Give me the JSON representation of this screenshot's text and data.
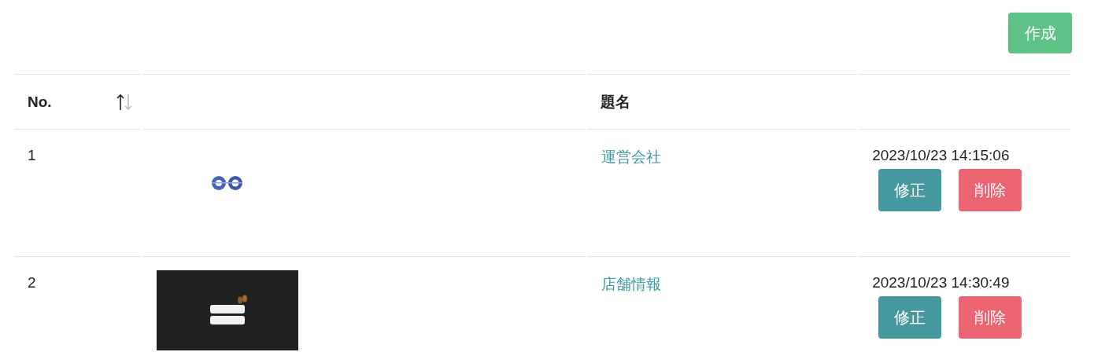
{
  "create_button": "作成",
  "table": {
    "columns": [
      {
        "label": "No.",
        "sortable": true
      },
      {
        "sortable": false
      },
      {
        "label": "題名",
        "sortable": false
      },
      {
        "sortable": false
      }
    ],
    "rows": [
      {
        "no": "1",
        "title": "運営会社",
        "date": "2023/10/23 14:15:06",
        "actions": [
          {
            "label": "修正",
            "kind": "edit"
          },
          {
            "label": "削除",
            "kind": "delete"
          }
        ]
      },
      {
        "no": "2",
        "title": "店舗情報",
        "date": "2023/10/23 14:30:49",
        "actions": [
          {
            "label": "修正",
            "kind": "edit"
          },
          {
            "label": "削除",
            "kind": "delete"
          }
        ]
      }
    ]
  }
}
